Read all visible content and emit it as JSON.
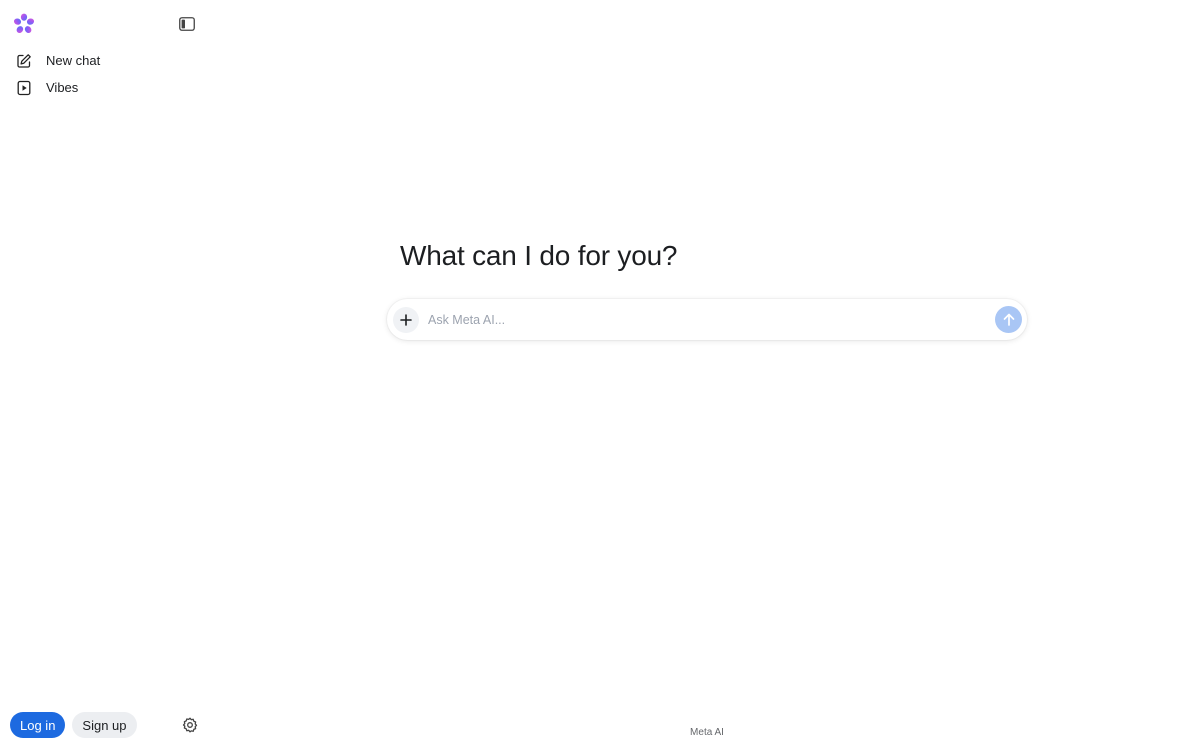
{
  "sidebar": {
    "logo_icon": "meta-ai-flower-icon",
    "toggle_icon": "sidebar-toggle-icon",
    "items": [
      {
        "label": "New chat",
        "icon": "edit-icon"
      },
      {
        "label": "Vibes",
        "icon": "play-icon"
      }
    ],
    "login_label": "Log in",
    "signup_label": "Sign up",
    "settings_icon": "gear-icon"
  },
  "main": {
    "headline": "What can I do for you?",
    "composer": {
      "placeholder": "Ask Meta AI...",
      "value": "",
      "add_icon": "plus-icon",
      "send_icon": "arrow-up-icon"
    }
  },
  "footer": {
    "text": "Meta AI"
  },
  "colors": {
    "primary": "#1d6ae0",
    "send_disabled": "#a9c6f5",
    "logo_gradient": [
      "#d946ef",
      "#8b5cf6",
      "#3b82f6"
    ]
  }
}
